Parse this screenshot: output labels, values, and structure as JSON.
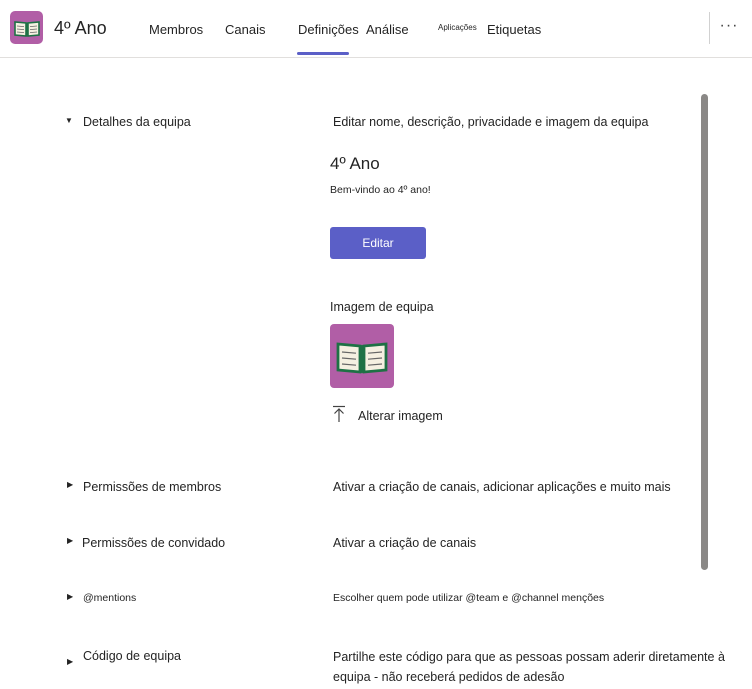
{
  "header": {
    "team_name": "4º Ano",
    "tabs": [
      {
        "label": "Membros"
      },
      {
        "label": "Canais"
      },
      {
        "label": "Definições",
        "active": true
      },
      {
        "label": "Análise"
      },
      {
        "label": "Aplicações"
      },
      {
        "label": "Etiquetas"
      }
    ],
    "more_label": "···",
    "accent_color": "#5b5fc7",
    "avatar_color": "#b15ea6"
  },
  "settings": {
    "team_details": {
      "label": "Detalhes da equipa",
      "description": "Editar nome, descrição, privacidade e imagem da equipa",
      "expanded": true,
      "team_title": "4º Ano",
      "team_subtitle": "Bem-vindo ao 4º ano!",
      "edit_button": "Editar",
      "image_label": "Imagem de equipa",
      "change_image": "Alterar imagem",
      "image_icon": "open-book-icon"
    },
    "member_permissions": {
      "label": "Permissões de membros",
      "description": "Ativar a criação de canais, adicionar aplicações e muito mais"
    },
    "guest_permissions": {
      "label": "Permissões de convidado",
      "description": "Ativar a criação de canais"
    },
    "mentions": {
      "label": "@mentions",
      "description": "Escolher quem pode utilizar @team e @channel menções"
    },
    "team_code": {
      "label": "Código de equipa",
      "description": "Partilhe este código para que as pessoas possam aderir diretamente à equipa - não receberá pedidos de adesão"
    }
  }
}
